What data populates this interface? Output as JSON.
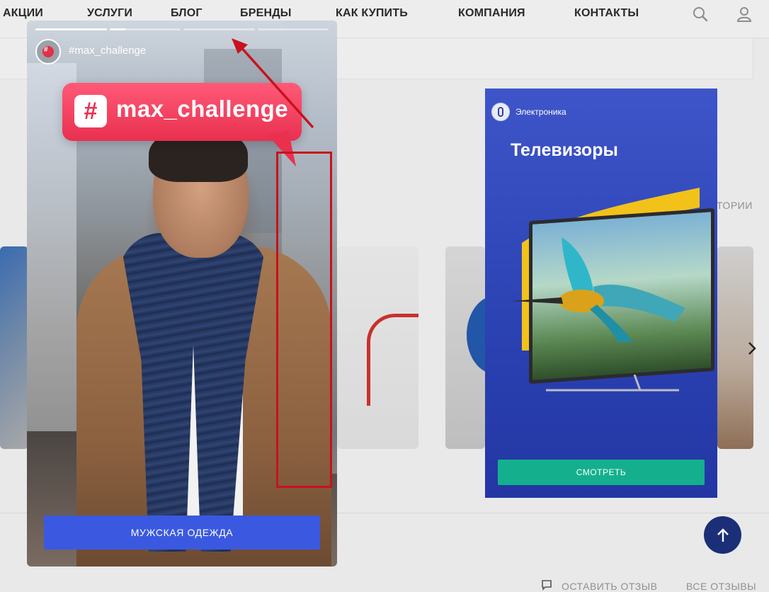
{
  "header": {
    "nav": [
      "АКЦИИ",
      "УСЛУГИ",
      "БЛОГ",
      "БРЕНДЫ",
      "КАК КУПИТЬ",
      "КОМПАНИЯ",
      "КОНТАКТЫ"
    ],
    "search_icon": "search-icon",
    "user_icon": "user-icon"
  },
  "background": {
    "side_link": "ТОРИИ",
    "footer_leave_review": "ОСТАВИТЬ ОТЗЫВ",
    "footer_all_reviews": "ВСЕ ОТЗЫВЫ",
    "next_icon": "chevron-right-icon",
    "scroll_top_icon": "arrow-up-icon"
  },
  "story_left": {
    "progress": [
      1,
      0.22,
      0,
      0
    ],
    "handle": "#max_challenge",
    "bubble_hash": "#",
    "bubble_text": "max_challenge",
    "cta": "МУЖСКАЯ ОДЕЖДА",
    "accent": "#3b59e0",
    "bubble_color": "#e9304f"
  },
  "story_right": {
    "author": "Электроника",
    "title": "Телевизоры",
    "cta": "СМОТРЕТЬ",
    "accent": "#14b08e",
    "bg": "#2c43b4"
  },
  "annotation": {
    "color": "#c8121c"
  }
}
